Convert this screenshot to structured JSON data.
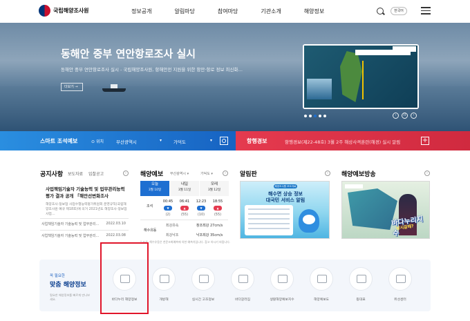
{
  "header": {
    "logo_text": "국립해양조사원",
    "nav": [
      "정보공개",
      "알림마당",
      "참여마당",
      "기관소개",
      "해양정보"
    ],
    "lang": "한국어"
  },
  "hero": {
    "title": "동해안 중부 연안항로조사 실시",
    "desc": "동해안 중부 연안항로조사 실시 - 국립해양조사원, 항해안전 지원을 위한 항만·항로 정보 최신화…",
    "more": "더보기",
    "ctrl_prev": "‹",
    "ctrl_pause": "II",
    "ctrl_next": "›"
  },
  "tide_strip": {
    "title": "스마트 조석예보",
    "location_label": "위치",
    "region": "부산광역시",
    "station": "가덕도"
  },
  "nav_warning": {
    "title": "항행경보",
    "text": "항행경보(제22-48호) 3월 2주 해상사격훈련(해경) 실시 알림"
  },
  "notice": {
    "title": "공지사항",
    "tabs": [
      "보도자료",
      "입찰공고"
    ],
    "headline": "사업책임기술자 기술능력 및 업무관리능력 평가 결과 공개 「해안선변화조사",
    "body": "해양조사·정보업 사업수행능력평가위원회 운영규칙(국립해양조사원 예규 제18호)에 의거 2021년도 해양조사·정보업 사업…",
    "rows": [
      {
        "text": "사업책임기술자 기술능력 및 업무관리…",
        "date": "2022.03.10"
      },
      {
        "text": "사업책임기술자 기술능력 및 업무관리…",
        "date": "2022.03.08"
      }
    ]
  },
  "forecast": {
    "title": "해양예보",
    "region_select": "부산광역시",
    "station_select": "가덕도",
    "days": [
      {
        "label": "오늘",
        "date": "3월 10일"
      },
      {
        "label": "내일",
        "date": "3월 11일"
      },
      {
        "label": "모레",
        "date": "3월 12일"
      }
    ],
    "tide_label": "조석",
    "times": [
      "00:45",
      "06:41",
      "12:23",
      "18:55"
    ],
    "levels": [
      "(2)",
      "(55)",
      "(10)",
      "(55)"
    ],
    "bath_label": "해수유동",
    "max_flow": "최강유속",
    "max_flow2": "최강낙조",
    "speed_label1": "창조최강",
    "speed_val1": "27cm/s",
    "speed_label2": "낙조최강",
    "speed_val2": "35cm/s",
    "note": "* 조석, 해수유동은 천문조화예측에 의한 예측치입니다. 참고 하시기 바랍니다."
  },
  "bulletin": {
    "title": "알림판",
    "poster_tag": "해양조사원 보도자료",
    "poster_line1": "해수면 상승 정보",
    "poster_line2": "대국민 서비스 알림"
  },
  "broadcast": {
    "title": "해양예보방송",
    "overlay1": "바다누리지수",
    "overlay2": "낚시갈때?"
  },
  "quick": {
    "small": "꼭 필요한",
    "big": "맞춤 해양정보",
    "desc": "필요한 해양정보를 빠르게 만나보세요.",
    "items": [
      "바다누리 해양정보",
      "개방해",
      "실시간 고조정보",
      "바다갈라짐",
      "생활해양예보지수",
      "해양예보도",
      "등대표",
      "위성센터"
    ]
  },
  "colors": {
    "tide_strip": "#2a8ee0",
    "warning_strip": "#e53a4f",
    "highlight": "#e0152a",
    "accent": "#1e6fd1"
  }
}
